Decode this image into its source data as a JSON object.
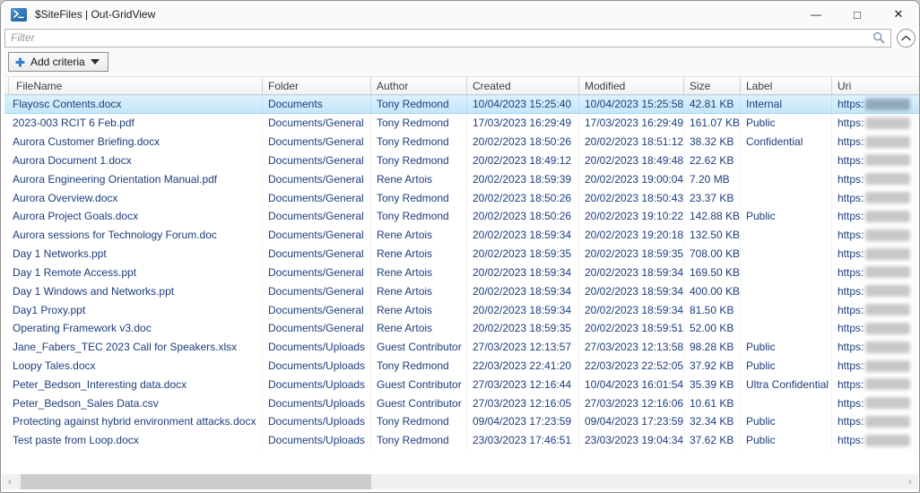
{
  "window": {
    "title": "$SiteFiles | Out-GridView",
    "app_icon": "powershell-icon",
    "controls": {
      "minimize": "—",
      "maximize": "□",
      "close": "✕"
    }
  },
  "filter": {
    "placeholder": "Filter",
    "value": ""
  },
  "toolbar": {
    "add_criteria_label": "Add criteria"
  },
  "table": {
    "columns": [
      "FileName",
      "Folder",
      "Author",
      "Created",
      "Modified",
      "Size",
      "Label",
      "Uri"
    ],
    "rows": [
      {
        "selected": true,
        "filename": "Flayosc Contents.docx",
        "folder": "Documents",
        "author": "Tony Redmond",
        "created": "10/04/2023 15:25:40",
        "modified": "10/04/2023 15:25:58",
        "size": "42.81 KB",
        "label": "Internal",
        "uri": "https:"
      },
      {
        "selected": false,
        "filename": "2023-003 RCIT 6 Feb.pdf",
        "folder": "Documents/General",
        "author": "Tony Redmond",
        "created": "17/03/2023 16:29:49",
        "modified": "17/03/2023 16:29:49",
        "size": "161.07 KB",
        "label": "Public",
        "uri": "https:"
      },
      {
        "selected": false,
        "filename": "Aurora Customer Briefing.docx",
        "folder": "Documents/General",
        "author": "Tony Redmond",
        "created": "20/02/2023 18:50:26",
        "modified": "20/02/2023 18:51:12",
        "size": "38.32 KB",
        "label": "Confidential",
        "uri": "https:"
      },
      {
        "selected": false,
        "filename": "Aurora Document 1.docx",
        "folder": "Documents/General",
        "author": "Tony Redmond",
        "created": "20/02/2023 18:49:12",
        "modified": "20/02/2023 18:49:48",
        "size": "22.62 KB",
        "label": "",
        "uri": "https:"
      },
      {
        "selected": false,
        "filename": "Aurora Engineering Orientation Manual.pdf",
        "folder": "Documents/General",
        "author": "Rene Artois",
        "created": "20/02/2023 18:59:39",
        "modified": "20/02/2023 19:00:04",
        "size": "7.20 MB",
        "label": "",
        "uri": "https:"
      },
      {
        "selected": false,
        "filename": "Aurora Overview.docx",
        "folder": "Documents/General",
        "author": "Tony Redmond",
        "created": "20/02/2023 18:50:26",
        "modified": "20/02/2023 18:50:43",
        "size": "23.37 KB",
        "label": "",
        "uri": "https:"
      },
      {
        "selected": false,
        "filename": "Aurora Project Goals.docx",
        "folder": "Documents/General",
        "author": "Tony Redmond",
        "created": "20/02/2023 18:50:26",
        "modified": "20/02/2023 19:10:22",
        "size": "142.88 KB",
        "label": "Public",
        "uri": "https:"
      },
      {
        "selected": false,
        "filename": "Aurora sessions for Technology Forum.doc",
        "folder": "Documents/General",
        "author": "Rene Artois",
        "created": "20/02/2023 18:59:34",
        "modified": "20/02/2023 19:20:18",
        "size": "132.50 KB",
        "label": "",
        "uri": "https:"
      },
      {
        "selected": false,
        "filename": "Day 1 Networks.ppt",
        "folder": "Documents/General",
        "author": "Rene Artois",
        "created": "20/02/2023 18:59:35",
        "modified": "20/02/2023 18:59:35",
        "size": "708.00 KB",
        "label": "",
        "uri": "https:"
      },
      {
        "selected": false,
        "filename": "Day 1 Remote Access.ppt",
        "folder": "Documents/General",
        "author": "Rene Artois",
        "created": "20/02/2023 18:59:34",
        "modified": "20/02/2023 18:59:34",
        "size": "169.50 KB",
        "label": "",
        "uri": "https:"
      },
      {
        "selected": false,
        "filename": "Day 1 Windows and Networks.ppt",
        "folder": "Documents/General",
        "author": "Rene Artois",
        "created": "20/02/2023 18:59:34",
        "modified": "20/02/2023 18:59:34",
        "size": "400.00 KB",
        "label": "",
        "uri": "https:"
      },
      {
        "selected": false,
        "filename": "Day1 Proxy.ppt",
        "folder": "Documents/General",
        "author": "Rene Artois",
        "created": "20/02/2023 18:59:34",
        "modified": "20/02/2023 18:59:34",
        "size": "81.50 KB",
        "label": "",
        "uri": "https:"
      },
      {
        "selected": false,
        "filename": "Operating Framework v3.doc",
        "folder": "Documents/General",
        "author": "Rene Artois",
        "created": "20/02/2023 18:59:35",
        "modified": "20/02/2023 18:59:51",
        "size": "52.00 KB",
        "label": "",
        "uri": "https:"
      },
      {
        "selected": false,
        "filename": "Jane_Fabers_TEC 2023 Call for Speakers.xlsx",
        "folder": "Documents/Uploads",
        "author": "Guest Contributor",
        "created": "27/03/2023 12:13:57",
        "modified": "27/03/2023 12:13:58",
        "size": "98.28 KB",
        "label": "Public",
        "uri": "https:"
      },
      {
        "selected": false,
        "filename": "Loopy Tales.docx",
        "folder": "Documents/Uploads",
        "author": "Tony Redmond",
        "created": "22/03/2023 22:41:20",
        "modified": "22/03/2023 22:52:05",
        "size": "37.92 KB",
        "label": "Public",
        "uri": "https:"
      },
      {
        "selected": false,
        "filename": "Peter_Bedson_Interesting data.docx",
        "folder": "Documents/Uploads",
        "author": "Guest Contributor",
        "created": "27/03/2023 12:16:44",
        "modified": "10/04/2023 16:01:54",
        "size": "35.39 KB",
        "label": "Ultra Confidential",
        "uri": "https:"
      },
      {
        "selected": false,
        "filename": "Peter_Bedson_Sales Data.csv",
        "folder": "Documents/Uploads",
        "author": "Guest Contributor",
        "created": "27/03/2023 12:16:05",
        "modified": "27/03/2023 12:16:06",
        "size": "10.61 KB",
        "label": "",
        "uri": "https:"
      },
      {
        "selected": false,
        "filename": "Protecting against hybrid environment attacks.docx",
        "folder": "Documents/Uploads",
        "author": "Tony Redmond",
        "created": "09/04/2023 17:23:59",
        "modified": "09/04/2023 17:23:59",
        "size": "32.34 KB",
        "label": "Public",
        "uri": "https:"
      },
      {
        "selected": false,
        "filename": "Test paste from Loop.docx",
        "folder": "Documents/Uploads",
        "author": "Tony Redmond",
        "created": "23/03/2023 17:46:51",
        "modified": "23/03/2023 19:04:34",
        "size": "37.62 KB",
        "label": "Public",
        "uri": "https:"
      }
    ]
  },
  "scrollbar": {
    "left_arrow": "‹",
    "right_arrow": "›"
  },
  "colors": {
    "row_text": "#1b3d7c",
    "selection_top": "#def2fd",
    "selection_bottom": "#c3e6f9",
    "powershell_blue": "#2a6fb3",
    "add_icon_blue": "#2f80d2"
  }
}
